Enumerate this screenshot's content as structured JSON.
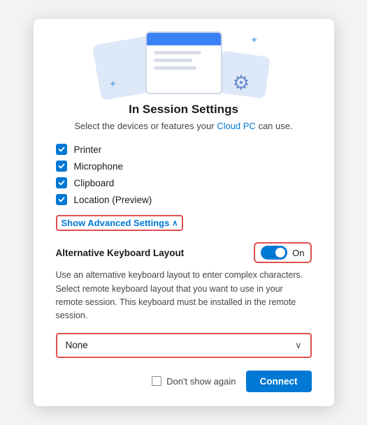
{
  "dialog": {
    "title": "In Session Settings",
    "subtitle": "Select the devices or features your",
    "subtitle_link": "Cloud PC",
    "subtitle_end": "can use.",
    "checkboxes": [
      {
        "label": "Printer",
        "checked": true
      },
      {
        "label": "Microphone",
        "checked": true
      },
      {
        "label": "Clipboard",
        "checked": true
      },
      {
        "label": "Location (Preview)",
        "checked": true
      }
    ],
    "advanced_link": "Show Advanced Settings",
    "keyboard_setting": {
      "label": "Alternative Keyboard Layout",
      "toggle_state": "On"
    },
    "description": "Use an alternative keyboard layout to enter complex characters. Select remote keyboard layout that you want to use in your remote session. This keyboard must be installed in the remote session.",
    "dropdown": {
      "value": "None",
      "placeholder": "None"
    },
    "footer": {
      "dont_show": "Don't show again",
      "connect": "Connect"
    }
  }
}
